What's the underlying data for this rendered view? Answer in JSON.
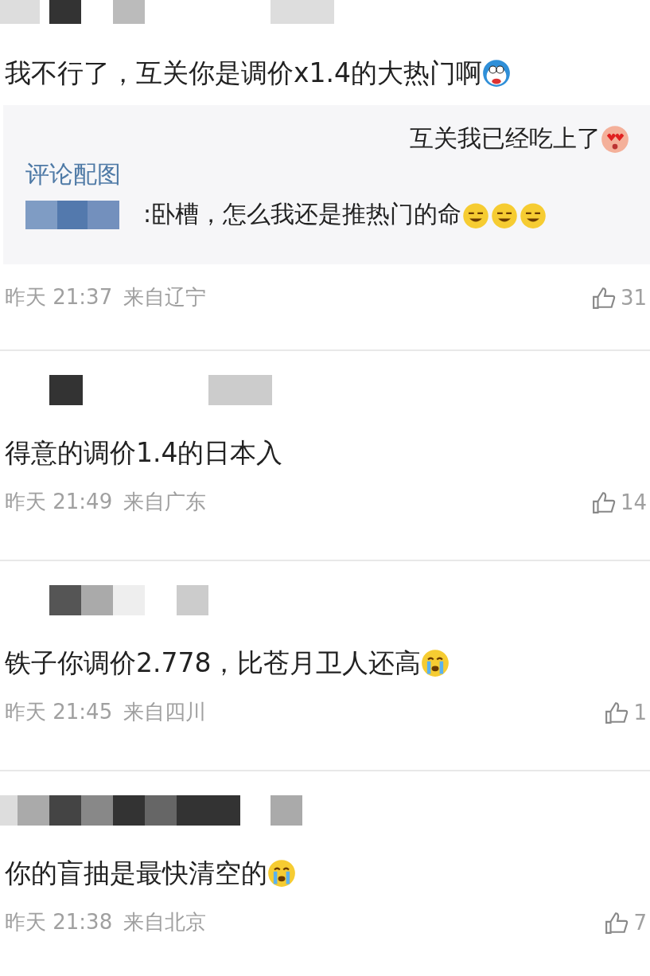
{
  "comments": [
    {
      "text": "我不行了，互关你是调价x1.4的大热门啊",
      "reply": {
        "quote": "互关我已经吃上了",
        "link": "评论配图",
        "text": ":卧槽，怎么我还是推热门的命"
      },
      "time": "昨天 21:37",
      "location": "来自辽宁",
      "likes": "31"
    },
    {
      "text": "得意的调价1.4的日本入",
      "time": "昨天 21:49",
      "location": "来自广东",
      "likes": "14"
    },
    {
      "text": "铁子你调价2.778，比苍月卫人还高",
      "time": "昨天 21:45",
      "location": "来自四川",
      "likes": "1"
    },
    {
      "text": "你的盲抽是最快清空的",
      "time": "昨天 21:38",
      "location": "来自北京",
      "likes": "7"
    }
  ]
}
